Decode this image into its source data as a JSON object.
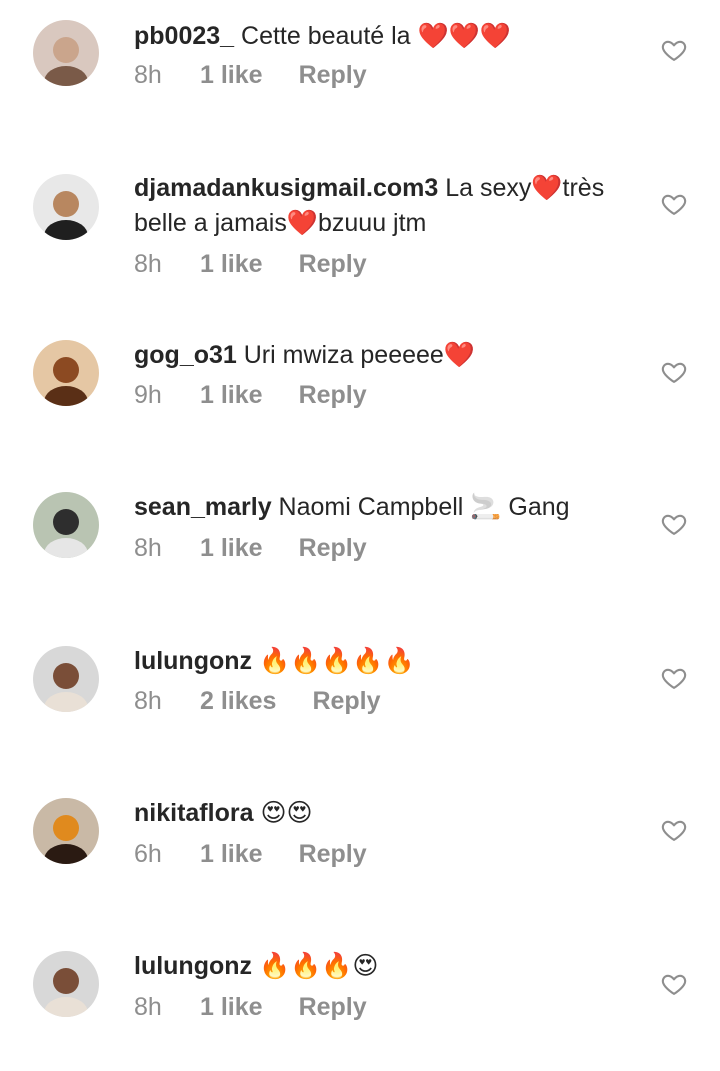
{
  "comments": [
    {
      "username": "pb0023_",
      "text": " Cette beauté la ",
      "emoji": "❤️❤️❤️",
      "text_after": "",
      "time": "8h",
      "likes": "1 like",
      "reply": "Reply",
      "avatar_colors": [
        "#d9c8bf",
        "#caa58c",
        "#7a5a48"
      ]
    },
    {
      "username": "djamadankusigmail.com3",
      "text": " La sexy",
      "emoji": "❤️",
      "text_after": "très belle a jamais❤️bzuuu jtm",
      "time": "8h",
      "likes": "1 like",
      "reply": "Reply",
      "avatar_colors": [
        "#e8e8e8",
        "#b88760",
        "#1f1f1f"
      ]
    },
    {
      "username": "gog_o31",
      "text": " Uri mwiza peeeee",
      "emoji": "❤️",
      "text_after": "",
      "time": "9h",
      "likes": "1 like",
      "reply": "Reply",
      "avatar_colors": [
        "#e5c7a4",
        "#8c4a22",
        "#5a2f16"
      ]
    },
    {
      "username": "sean_marly",
      "text": " Naomi Campbell ",
      "emoji": "🚬",
      "text_after": " Gang",
      "time": "8h",
      "likes": "1 like",
      "reply": "Reply",
      "avatar_colors": [
        "#b9c4b2",
        "#2e2e2e",
        "#e6e6e6"
      ]
    },
    {
      "username": "lulungonz",
      "text": " ",
      "emoji": "🔥🔥🔥🔥🔥",
      "text_after": "",
      "time": "8h",
      "likes": "2 likes",
      "reply": "Reply",
      "avatar_colors": [
        "#d8d8d8",
        "#7a4e38",
        "#e9e0d6"
      ]
    },
    {
      "username": "nikitaflora",
      "text": " ",
      "emoji": "😍😍",
      "text_after": "",
      "time": "6h",
      "likes": "1 like",
      "reply": "Reply",
      "avatar_colors": [
        "#c9b9a6",
        "#e08a1e",
        "#2a1a12"
      ]
    },
    {
      "username": "lulungonz",
      "text": " ",
      "emoji": "🔥🔥🔥😍",
      "text_after": "",
      "time": "8h",
      "likes": "1 like",
      "reply": "Reply",
      "avatar_colors": [
        "#d8d8d8",
        "#7a4e38",
        "#e9e0d6"
      ]
    }
  ],
  "colors": {
    "text": "#262626",
    "muted": "#8e8e8e",
    "heart_outline": "#8e8e8e"
  }
}
